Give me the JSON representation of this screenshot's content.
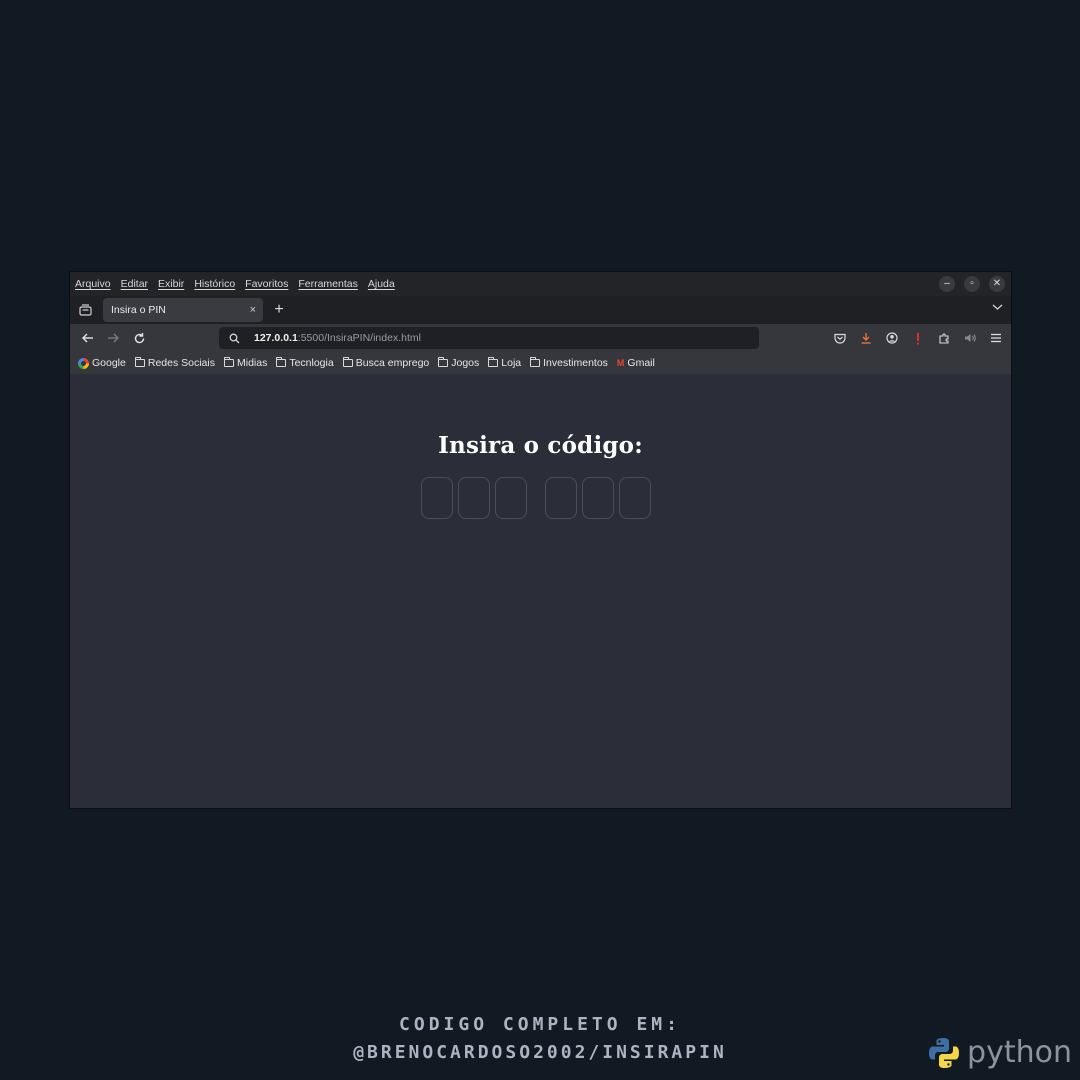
{
  "menubar": {
    "items": [
      "Arquivo",
      "Editar",
      "Exibir",
      "Histórico",
      "Favoritos",
      "Ferramentas",
      "Ajuda"
    ]
  },
  "window_controls": {
    "minimize": "–",
    "restore": "▫",
    "close": "✕"
  },
  "tab": {
    "title": "Insira o PIN",
    "close": "×",
    "new_tab": "+"
  },
  "urlbar": {
    "host": "127.0.0.1",
    "path": ":5500/InsiraPIN/index.html"
  },
  "bookmarks": [
    {
      "label": "Google",
      "icon": "google-icon"
    },
    {
      "label": "Redes Sociais",
      "icon": "folder-icon"
    },
    {
      "label": "Midias",
      "icon": "folder-icon"
    },
    {
      "label": "Tecnlogia",
      "icon": "folder-icon"
    },
    {
      "label": "Busca emprego",
      "icon": "folder-icon"
    },
    {
      "label": "Jogos",
      "icon": "folder-icon"
    },
    {
      "label": "Loja",
      "icon": "folder-icon"
    },
    {
      "label": "Investimentos",
      "icon": "folder-icon"
    },
    {
      "label": "Gmail",
      "icon": "gmail-icon"
    }
  ],
  "page": {
    "title": "Insira o código:",
    "pin_values": [
      "",
      "",
      "",
      "",
      "",
      ""
    ]
  },
  "footer": {
    "line1": "CODIGO COMPLETO EM:",
    "line2": "@BRENOCARDOSO2002/INSIRAPIN"
  },
  "brand": {
    "word": "python"
  },
  "colors": {
    "background": "#111a22",
    "page_bg": "#2b2d38",
    "pin_border": "#4a4d5c",
    "python_blue": "#3d6fa0",
    "python_yellow": "#f5d54a"
  }
}
